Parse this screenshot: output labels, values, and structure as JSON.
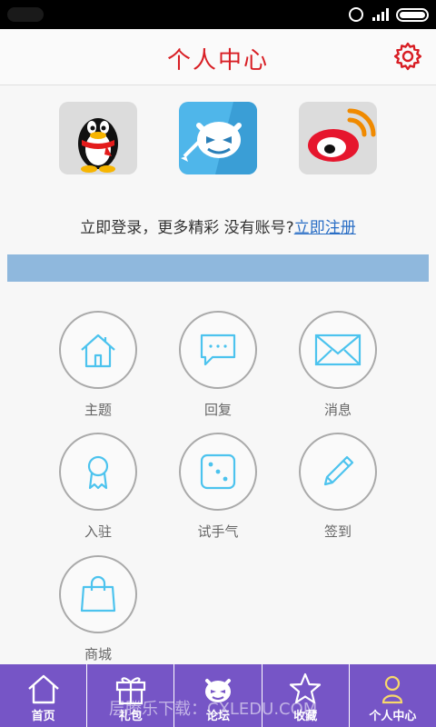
{
  "header": {
    "title": "个人中心",
    "settings_icon": "gear-icon",
    "accent": "#d81e24"
  },
  "login": {
    "providers": [
      {
        "name": "qq",
        "icon": "qq-penguin-icon"
      },
      {
        "name": "mascot",
        "icon": "cartoon-mascot-icon"
      },
      {
        "name": "weibo",
        "icon": "weibo-icon"
      }
    ],
    "prompt": "立即登录，更多精彩  没有账号?",
    "register_link": "立即注册"
  },
  "grid": [
    {
      "label": "主题",
      "icon": "home-icon"
    },
    {
      "label": "回复",
      "icon": "chat-bubble-icon"
    },
    {
      "label": "消息",
      "icon": "envelope-icon"
    },
    {
      "label": "入驻",
      "icon": "award-ribbon-icon"
    },
    {
      "label": "试手气",
      "icon": "dice-icon"
    },
    {
      "label": "签到",
      "icon": "pencil-icon"
    },
    {
      "label": "商城",
      "icon": "shopping-bag-icon"
    }
  ],
  "tabs": [
    {
      "label": "首页",
      "icon": "home-icon"
    },
    {
      "label": "礼包",
      "icon": "gift-icon"
    },
    {
      "label": "论坛",
      "icon": "mascot-face-icon"
    },
    {
      "label": "收藏",
      "icon": "star-icon"
    },
    {
      "label": "个人中心",
      "icon": "person-icon",
      "active": true
    }
  ],
  "tab_color": "#7655c6",
  "watermark": "层腾乐下载：CXLEDU.COM"
}
